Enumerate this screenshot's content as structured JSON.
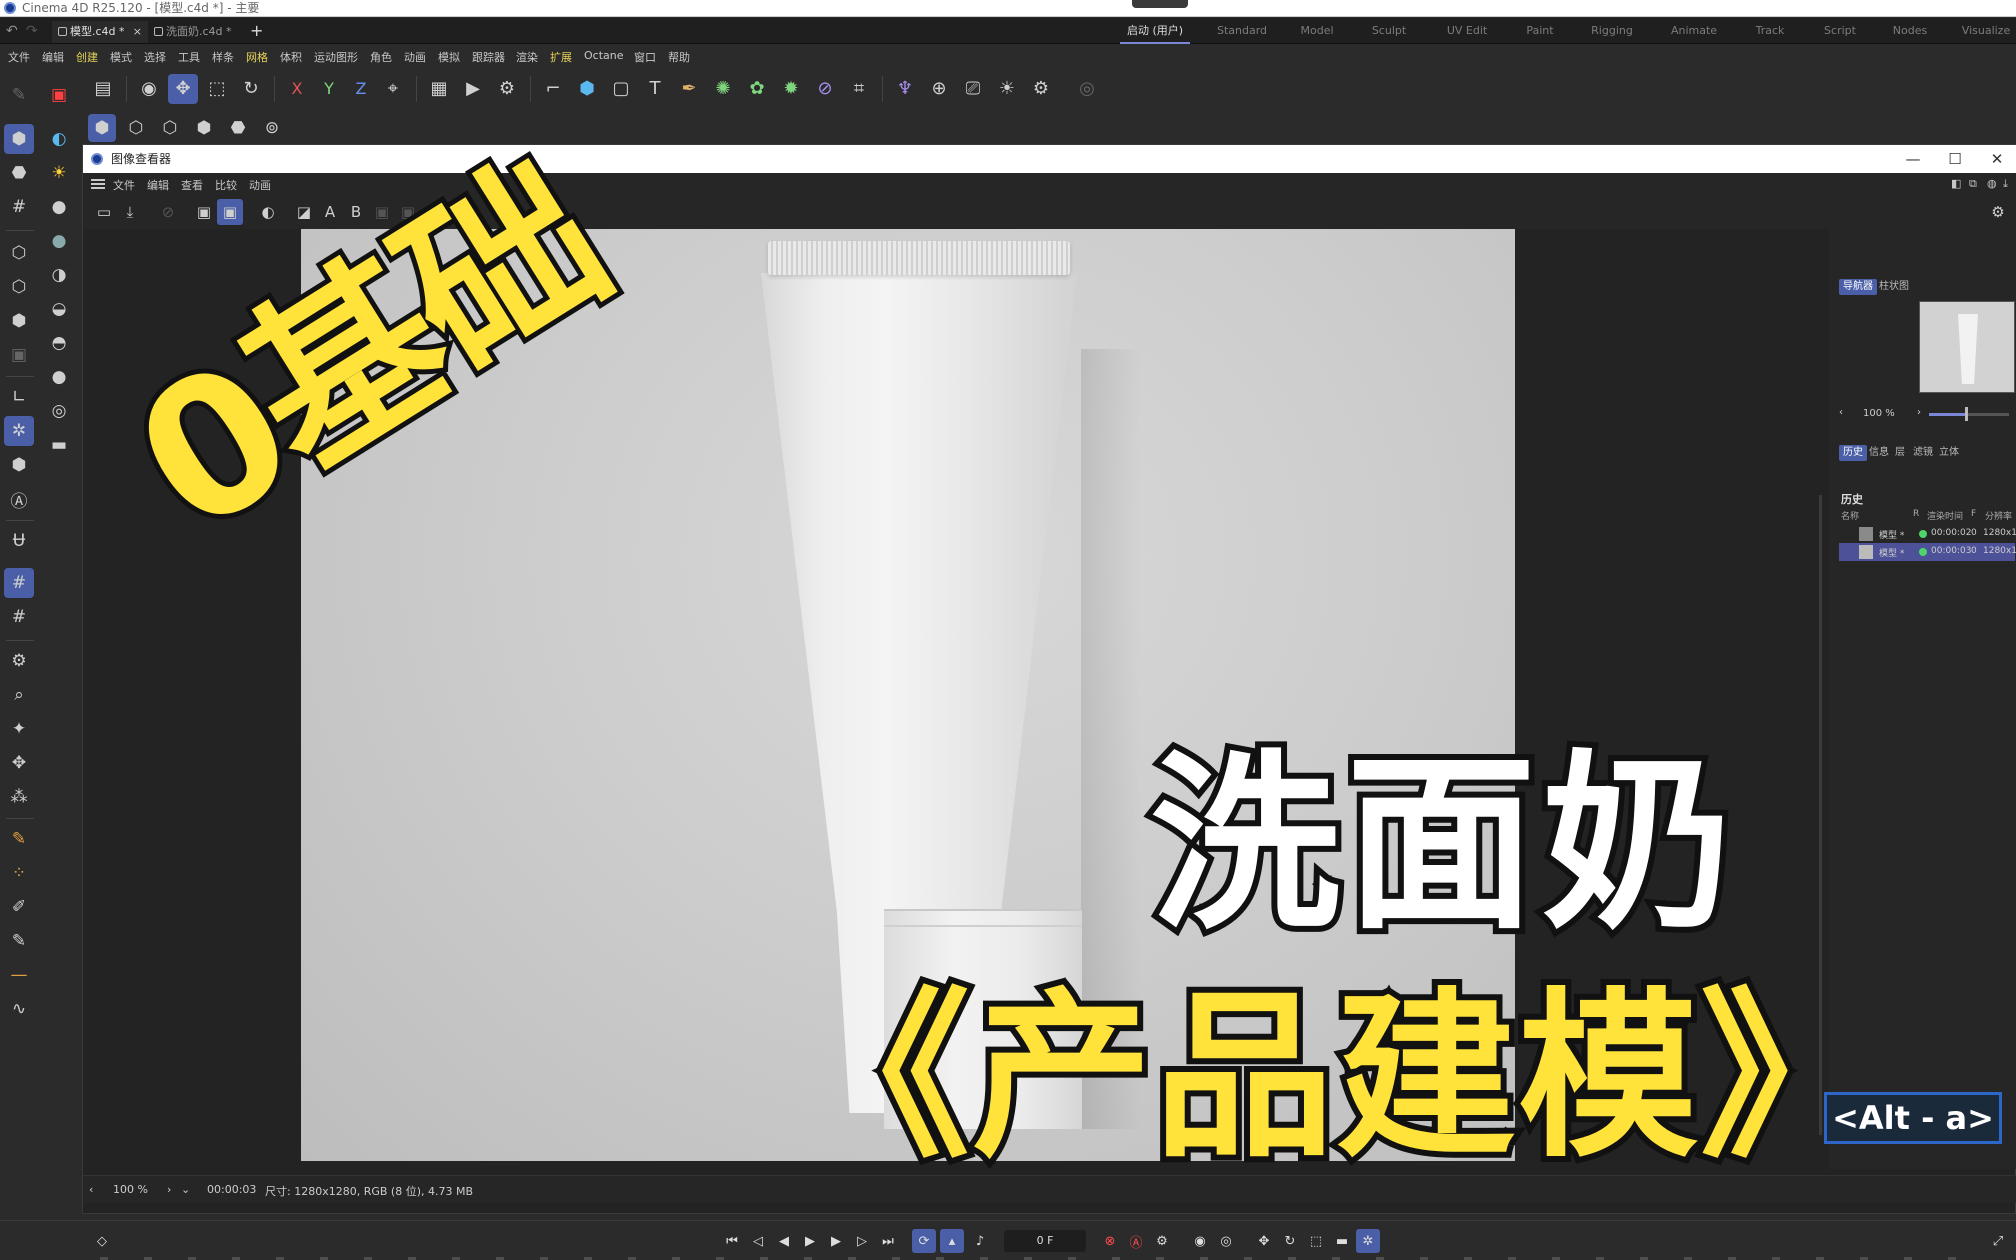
{
  "window": {
    "title": "Cinema 4D R25.120 - [模型.c4d *] - 主要"
  },
  "doc_tabs": [
    {
      "label": "模型.c4d *",
      "active": true
    },
    {
      "label": "洗面奶.c4d *",
      "active": false
    }
  ],
  "layouts": [
    {
      "label": "启动 (用户)",
      "active": true
    },
    {
      "label": "Standard"
    },
    {
      "label": "Model"
    },
    {
      "label": "Sculpt"
    },
    {
      "label": "UV Edit"
    },
    {
      "label": "Paint"
    },
    {
      "label": "Rigging"
    },
    {
      "label": "Animate"
    },
    {
      "label": "Track"
    },
    {
      "label": "Script"
    },
    {
      "label": "Nodes"
    },
    {
      "label": "Visualize"
    }
  ],
  "menu": [
    {
      "label": "文件"
    },
    {
      "label": "编辑"
    },
    {
      "label": "创建",
      "hl": true
    },
    {
      "label": "模式"
    },
    {
      "label": "选择"
    },
    {
      "label": "工具"
    },
    {
      "label": "样条"
    },
    {
      "label": "网格",
      "hl": true
    },
    {
      "label": "体积"
    },
    {
      "label": "运动图形"
    },
    {
      "label": "角色"
    },
    {
      "label": "动画"
    },
    {
      "label": "模拟"
    },
    {
      "label": "跟踪器"
    },
    {
      "label": "渲染"
    },
    {
      "label": "扩展",
      "hl": true
    },
    {
      "label": "Octane"
    },
    {
      "label": "窗口"
    },
    {
      "label": "帮助"
    }
  ],
  "toolbar": {
    "axis_x": "X",
    "axis_y": "Y",
    "axis_z": "Z",
    "text_tool": "T"
  },
  "viewer": {
    "title": "图像查看器",
    "menu": [
      "文件",
      "编辑",
      "查看",
      "比较",
      "动画"
    ],
    "tool_a": "A",
    "tool_b": "B",
    "minimize": "—",
    "maximize": "☐",
    "close": "✕"
  },
  "overlay": {
    "line1": "0基础",
    "line2": "洗面奶",
    "line3": "《产品建模》"
  },
  "right_panel": {
    "tabs_top": [
      "导航器",
      "柱状图"
    ],
    "zoom": "100 %",
    "tabs_mid": [
      "历史",
      "信息",
      "层",
      "滤镜",
      "立体"
    ],
    "history_title": "历史",
    "columns": [
      "名称",
      "R",
      "渲染时间",
      "F",
      "分辨率"
    ],
    "rows": [
      {
        "name": "模型 *",
        "time": "00:00:02",
        "f": "0",
        "res": "1280x1280",
        "selected": false
      },
      {
        "name": "模型 *",
        "time": "00:00:03",
        "f": "0",
        "res": "1280x1280",
        "selected": true
      }
    ]
  },
  "status": {
    "zoom": "100 %",
    "time": "00:00:03",
    "info": "尺寸: 1280x1280, RGB (8 位), 4.73 MB"
  },
  "shortcut": "<Alt - a>",
  "timeline": {
    "frame": "0 F"
  },
  "colors": {
    "accent": "#4b5fa8",
    "overlay_yellow": "#ffe23a",
    "record_red": "#ff4d4d",
    "status_green": "#4fd36a"
  }
}
